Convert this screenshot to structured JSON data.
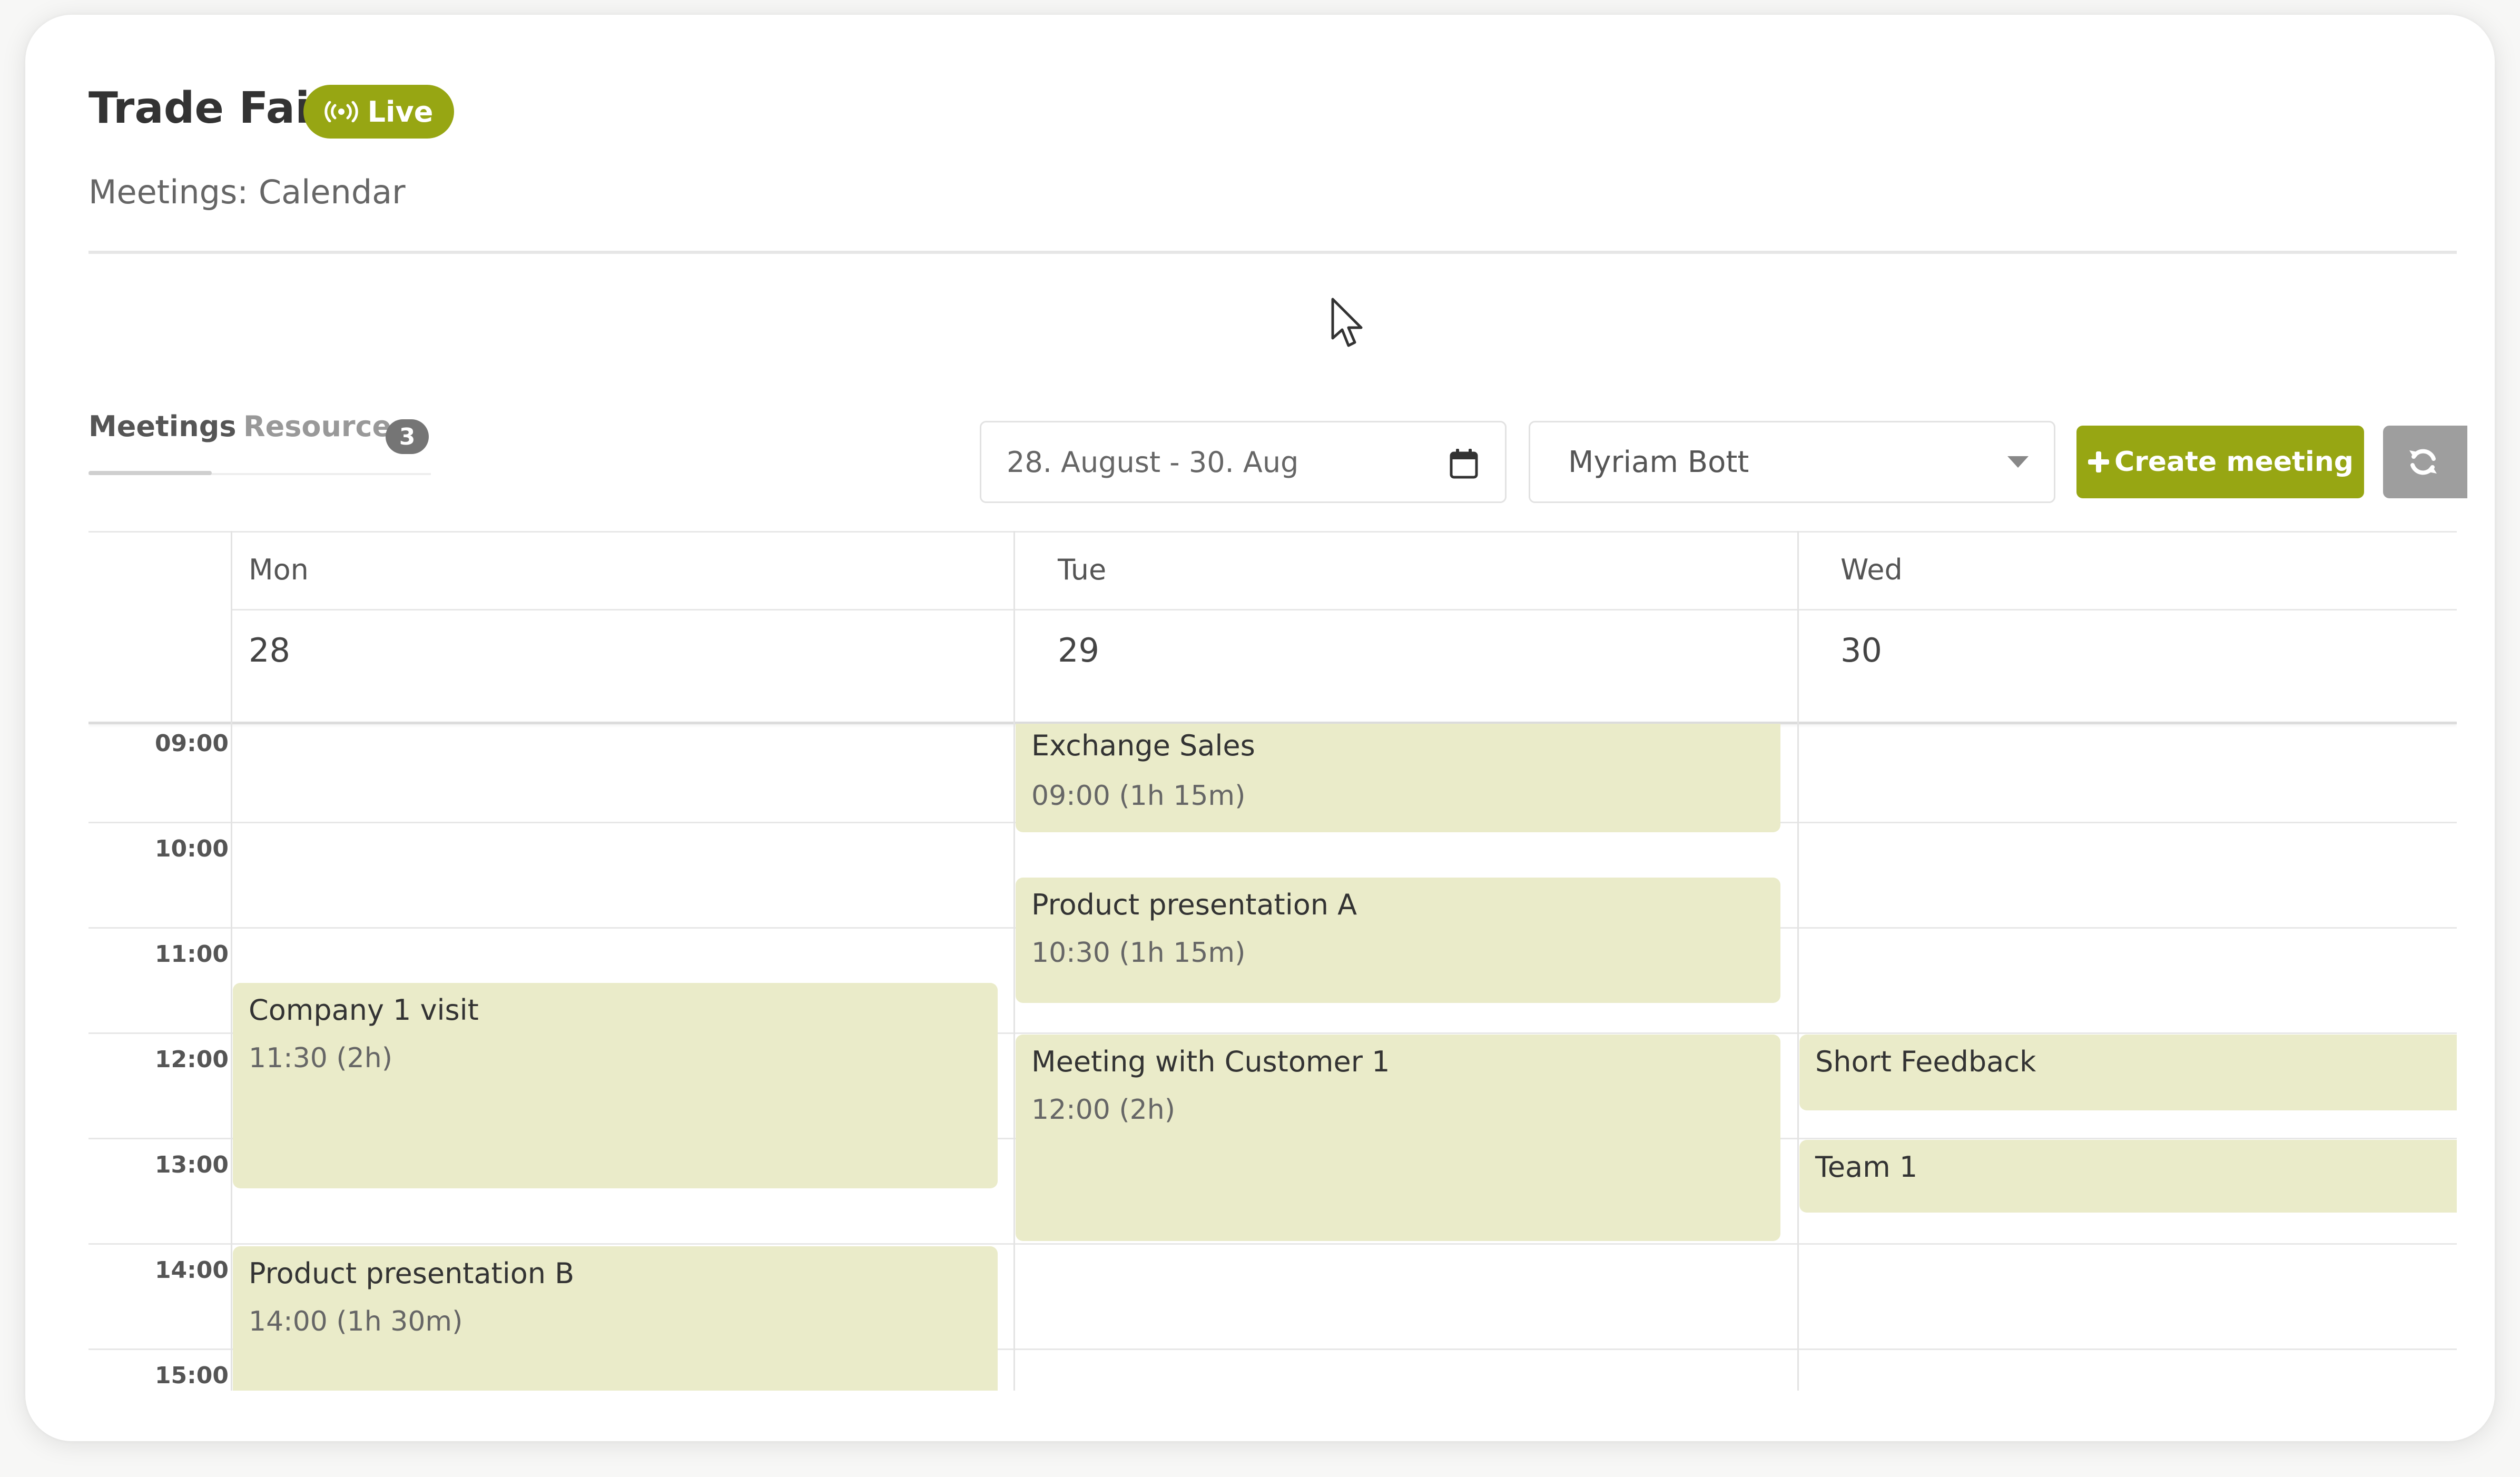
{
  "header": {
    "title": "Trade Fair",
    "status_badge": "Live",
    "subtitle": "Meetings: Calendar"
  },
  "tabs": [
    {
      "label": "Meetings",
      "active": true
    },
    {
      "label": "Resources",
      "count": "3"
    }
  ],
  "toolbar": {
    "date_range": "28. August - 30. Aug",
    "user_select": "Myriam Bott",
    "create_label": "Create meeting",
    "icons": {
      "date": "calendar-icon",
      "create": "plus-icon",
      "refresh": "refresh-icon",
      "live": "broadcast-icon"
    }
  },
  "calendar": {
    "days": [
      {
        "name": "Mon",
        "date": "28"
      },
      {
        "name": "Tue",
        "date": "29"
      },
      {
        "name": "Wed",
        "date": "30"
      }
    ],
    "hours": [
      "09:00",
      "10:00",
      "11:00",
      "12:00",
      "13:00",
      "14:00",
      "15:00"
    ],
    "events": [
      {
        "title": "Exchange Sales",
        "time": "09:00 (1h 15m)",
        "day": "Tue"
      },
      {
        "title": "Product presentation A",
        "time": "10:30 (1h 15m)",
        "day": "Tue"
      },
      {
        "title": "Company 1 visit",
        "time": "11:30 (2h)",
        "day": "Mon"
      },
      {
        "title": "Meeting with Customer 1",
        "time": "12:00 (2h)",
        "day": "Tue"
      },
      {
        "title": "Short Feedback",
        "time": "",
        "day": "Wed"
      },
      {
        "title": "Team 1",
        "time": "",
        "day": "Wed"
      },
      {
        "title": "Product presentation B",
        "time": "14:00 (1h 30m)",
        "day": "Mon"
      }
    ]
  },
  "colors": {
    "accent": "#97a613",
    "event_bg": "#eaebc9",
    "badge_gray": "#757575"
  }
}
